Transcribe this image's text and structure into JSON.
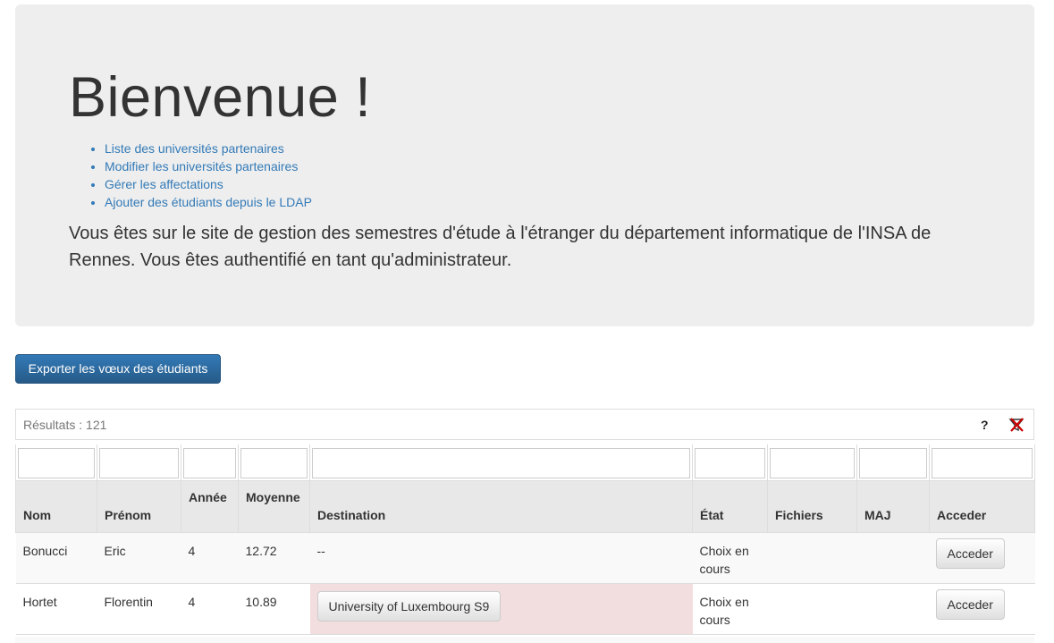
{
  "hero": {
    "title": "Bienvenue !",
    "links": [
      "Liste des universités partenaires",
      "Modifier les universités partenaires",
      "Gérer les affectations",
      "Ajouter des étudiants depuis le LDAP"
    ],
    "intro": "Vous êtes sur le site de gestion des semestres d'étude à l'étranger du département informatique de l'INSA de Rennes. Vous êtes authentifié en tant qu'administrateur."
  },
  "export_button": "Exporter les vœux des étudiants",
  "results": {
    "label": "Résultats : 121",
    "help": "?"
  },
  "table": {
    "headers": [
      "Nom",
      "Prénom",
      "Année",
      "Moyenne",
      "Destination",
      "État",
      "Fichiers",
      "MAJ",
      "Acceder"
    ],
    "rows": [
      {
        "nom": "Bonucci",
        "prenom": "Eric",
        "annee": "4",
        "moyenne": "12.72",
        "destination": "--",
        "etat": "Choix en cours",
        "fichiers": "",
        "maj": "",
        "action": "Acceder"
      },
      {
        "nom": "Hortet",
        "prenom": "Florentin",
        "annee": "4",
        "moyenne": "10.89",
        "destination": "University of Luxembourg S9",
        "etat": "Choix en cours",
        "fichiers": "",
        "maj": "",
        "action": "Acceder"
      }
    ]
  }
}
